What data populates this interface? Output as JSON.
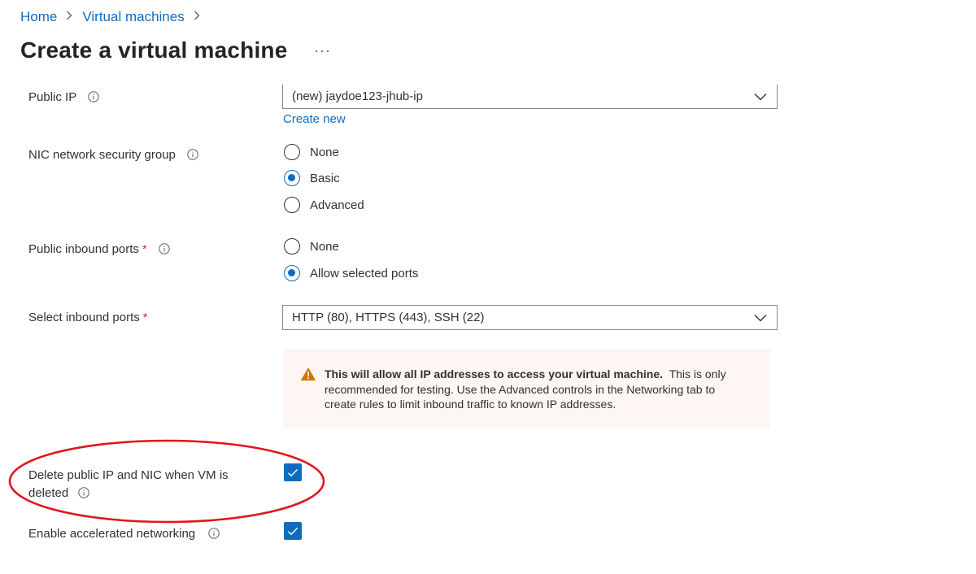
{
  "breadcrumb": {
    "items": [
      "Home",
      "Virtual machines"
    ]
  },
  "page": {
    "title": "Create a virtual machine",
    "more_label": "···"
  },
  "public_ip": {
    "label": "Public IP",
    "value": "(new) jaydoe123-jhub-ip",
    "create_new": "Create new"
  },
  "nic_nsg": {
    "label": "NIC network security group",
    "options": [
      "None",
      "Basic",
      "Advanced"
    ],
    "selected": "Basic"
  },
  "public_inbound_ports": {
    "label": "Public inbound ports",
    "required_mark": "*",
    "options": [
      "None",
      "Allow selected ports"
    ],
    "selected": "Allow selected ports"
  },
  "select_inbound_ports": {
    "label": "Select inbound ports",
    "required_mark": "*",
    "value": "HTTP (80), HTTPS (443), SSH (22)"
  },
  "warning": {
    "bold": "This will allow all IP addresses to access your virtual machine.",
    "line1_rest": "This is only",
    "line2": "recommended for testing.  Use the Advanced controls in the Networking tab to",
    "line3": "create rules to limit inbound traffic to known IP addresses."
  },
  "delete_public_ip": {
    "label_line1": "Delete public IP and NIC when VM is",
    "label_line2": "deleted",
    "checked": true
  },
  "accelerated_networking": {
    "label": "Enable accelerated networking",
    "checked": true
  },
  "colors": {
    "accent": "#0f6cbd",
    "warning_bg": "#fdf6f2",
    "warning_icon": "#d47500",
    "annotation": "#e0161b"
  }
}
